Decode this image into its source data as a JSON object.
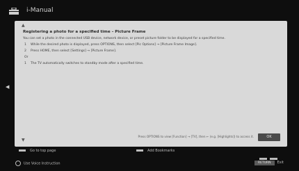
{
  "header": {
    "title": "i-Manual",
    "icon": "toolbox-icon"
  },
  "content": {
    "heading": "Registering a photo for a specified time – Picture Frame",
    "intro": "You can set a photo in the connected USB device, network device, or preset picture folder to be displayed for a specified time.",
    "steps": [
      {
        "num": "1",
        "text": "While the desired photo is displayed, press OPTIONS, then select [Pic Options] → [Picture Frame Image]."
      },
      {
        "num": "2",
        "text": "Press HOME, then select [Settings] → [Picture Frame]."
      }
    ],
    "or_label": "Or",
    "steps_after": [
      {
        "num": "1",
        "text": "The TV automatically switches to standby mode after a specified time."
      }
    ],
    "footer_note": "Press OPTIONS to view [Function] → [TV], then ← (e.g. [Highlights]) to access it.",
    "ok_label": "OK"
  },
  "bottombar": {
    "left_item": "Go to top page",
    "middle_item": "Add Bookmarks",
    "globe_item": "Use Voice Instruction",
    "return_key": "RETURN",
    "exit_label": "Exit"
  }
}
